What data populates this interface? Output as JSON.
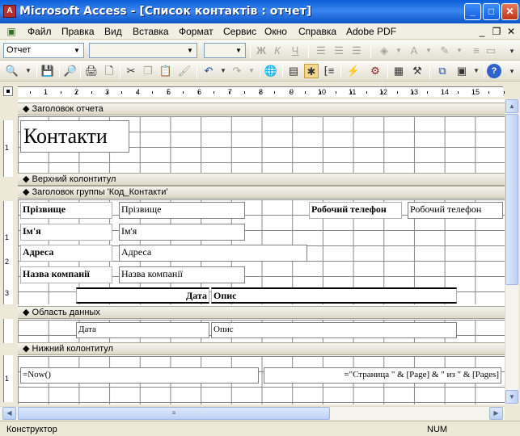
{
  "window": {
    "title": "Microsoft Access - [Список контактів : отчет]",
    "minimize": "_",
    "maximize": "□",
    "close": "✕"
  },
  "menu": {
    "items": [
      "Файл",
      "Правка",
      "Вид",
      "Вставка",
      "Формат",
      "Сервис",
      "Окно",
      "Справка",
      "Adobe PDF"
    ],
    "doc_minimize": "_",
    "doc_restore": "❐",
    "doc_close": "✕"
  },
  "format_toolbar": {
    "object_combo": "Отчет",
    "font_combo": "",
    "size_combo": "",
    "bold": "Ж",
    "italic": "К",
    "underline": "Ч"
  },
  "ruler": {
    "numbers": [
      "1",
      "2",
      "3",
      "4",
      "5",
      "6",
      "7",
      "8",
      "9",
      "10",
      "11",
      "12",
      "13",
      "14",
      "15"
    ]
  },
  "vruler": {
    "numbers": [
      "1",
      "2",
      "3"
    ]
  },
  "sections": {
    "report_header": "Заголовок отчета",
    "page_header": "Верхний колонтитул",
    "group_header": "Заголовок группы 'Код_Контакти'",
    "detail": "Область данных",
    "page_footer": "Нижний колонтитул"
  },
  "report_header": {
    "title": "Контакти"
  },
  "group": {
    "surname_label": "Прізвище",
    "surname_field": "Прізвище",
    "phone_label": "Робочий телефон",
    "phone_field": "Робочий телефон",
    "name_label": "Ім'я",
    "name_field": "Ім'я",
    "address_label": "Адреса",
    "address_field": "Адреса",
    "company_label": "Назва компанії",
    "company_field": "Назва компанії",
    "date_col": "Дата",
    "desc_col": "Опис"
  },
  "detail": {
    "date_field": "Дата",
    "desc_field": "Опис"
  },
  "footer": {
    "now_field": "=Now()",
    "page_field": "=\"Страница \" & [Page] & \" из \" & [Pages]"
  },
  "status": {
    "mode": "Конструктор",
    "num": "NUM"
  }
}
